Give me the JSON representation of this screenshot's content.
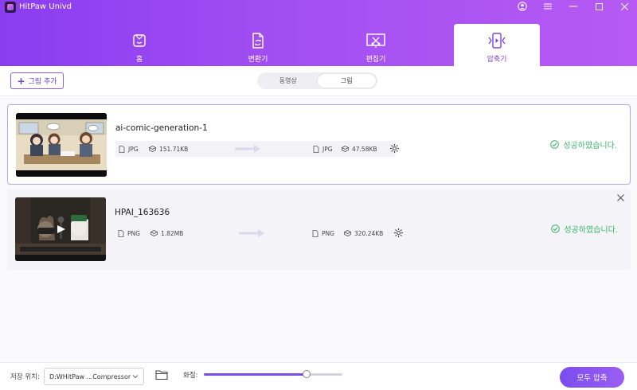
{
  "app": {
    "title": "HitPaw Univd"
  },
  "nav": {
    "tabs": [
      {
        "label": "홈",
        "icon": "home-icon"
      },
      {
        "label": "변환기",
        "icon": "converter-icon"
      },
      {
        "label": "편집기",
        "icon": "editor-icon"
      },
      {
        "label": "압축기",
        "icon": "compressor-icon",
        "active": true
      }
    ]
  },
  "toolbar": {
    "add_label": "그림 추가",
    "segments": [
      {
        "label": "동영상"
      },
      {
        "label": "그림",
        "active": true
      }
    ]
  },
  "files": [
    {
      "name": "ai-comic-generation-1",
      "src_format": "JPG",
      "src_size": "151.71KB",
      "dst_format": "JPG",
      "dst_size": "47.58KB",
      "status": "성공하였습니다."
    },
    {
      "name": "HPAI_163636",
      "src_format": "PNG",
      "src_size": "1.82MB",
      "dst_format": "PNG",
      "dst_size": "320.24KB",
      "status": "성공하였습니다."
    }
  ],
  "footer": {
    "save_label": "저장 위치:",
    "save_path": "D:WHitPaw ...Compressor",
    "quality_label": "화질:",
    "quality_value": 0.74,
    "compress_all_label": "모두 압축"
  },
  "colors": {
    "accent": "#7a42e6",
    "success": "#37b569"
  }
}
